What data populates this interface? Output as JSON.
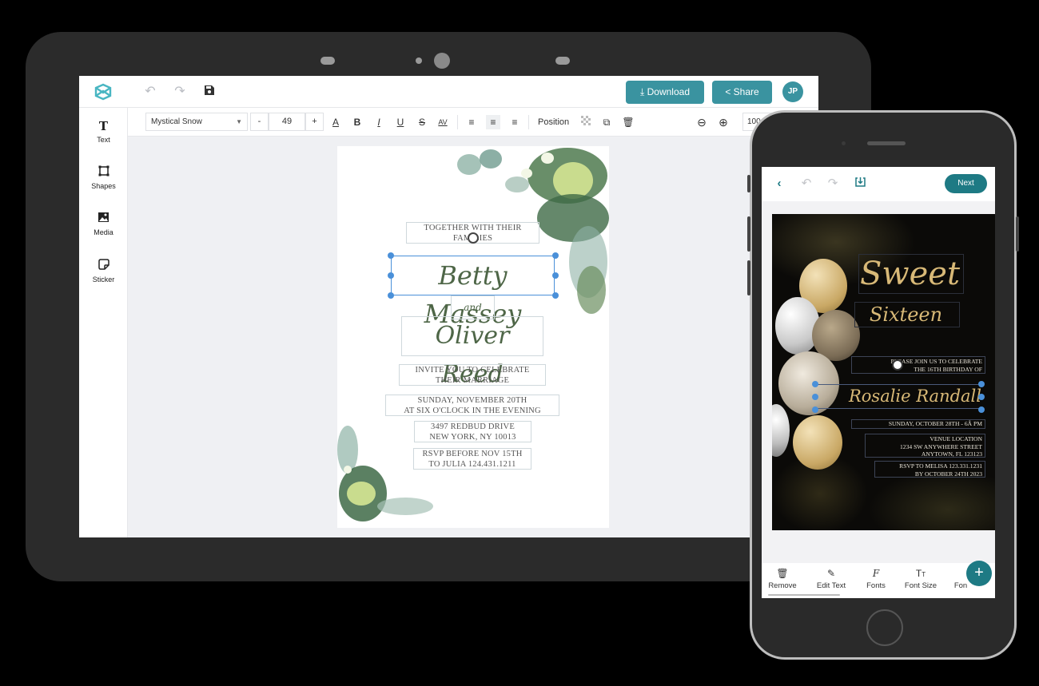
{
  "desktop": {
    "topbar": {
      "logo": "app-logo-icon",
      "undo_icon": "undo-icon",
      "redo_icon": "redo-icon",
      "save_icon": "save-icon",
      "download_label": "Download",
      "download_icon": "download-icon",
      "share_label": "Share",
      "share_icon": "share-icon",
      "avatar_initials": "JP",
      "accent_color": "#3a93a0"
    },
    "sidebar": {
      "items": [
        {
          "label": "Text",
          "icon": "text-icon"
        },
        {
          "label": "Shapes",
          "icon": "shapes-icon"
        },
        {
          "label": "Media",
          "icon": "media-icon"
        },
        {
          "label": "Sticker",
          "icon": "sticker-icon"
        }
      ]
    },
    "format_bar": {
      "font_family": "Mystical Snow",
      "decrease_label": "-",
      "font_size": "49",
      "increase_label": "+",
      "format_buttons": [
        "text-color",
        "bold",
        "italic",
        "underline",
        "strikethrough",
        "letter-spacing"
      ],
      "align_buttons": [
        "align-left",
        "align-center",
        "align-right"
      ],
      "align_active": "align-center",
      "position_label": "Position",
      "zoom_value": "100"
    },
    "invitation": {
      "line1": "TOGETHER WITH THEIR",
      "line2": "FAMILIES",
      "bride": "Betty Massey",
      "and": "and",
      "groom": "Oliver Reed",
      "invite_line1": "INVITE YOU TO CELEBRATE",
      "invite_line2": "THEIR MARRIAGE",
      "date_line1": "SUNDAY, NOVEMBER 20TH",
      "date_line2": "AT SIX O'CLOCK IN THE EVENING",
      "address_line1": "3497 REDBUD DRIVE",
      "address_line2": "NEW YORK, NY 10013",
      "rsvp_line1": "RSVP BEFORE NOV 15TH",
      "rsvp_line2": "TO JULIA 124.431.1211"
    }
  },
  "mobile": {
    "topbar": {
      "back_icon": "chevron-left-icon",
      "undo_icon": "undo-icon",
      "redo_icon": "redo-icon",
      "save_icon": "download-box-icon",
      "next_label": "Next",
      "accent_color": "#1e7a84"
    },
    "card": {
      "title1": "Sweet",
      "title2": "Sixteen",
      "intro_line1": "PLEASE JOIN US TO CELEBRATE",
      "intro_line2": "THE 16TH BIRTHDAY OF",
      "name": "Rosalie Randall",
      "date": "SUNDAY, OCTOBER 28TH - 6Â PM",
      "venue_line1": "VENUE LOCATION",
      "venue_line2": "1234 SW ANYWHERE STREET",
      "venue_line3": "ANYTOWN, FL 123123",
      "rsvp_line1": "RSVP TO MELISA 123.331.1231",
      "rsvp_line2": "BY OCTOBER 24TH 2023"
    },
    "bottom_tools": [
      {
        "label": "Remove",
        "icon": "trash-icon"
      },
      {
        "label": "Edit Text",
        "icon": "pencil-icon"
      },
      {
        "label": "Fonts",
        "icon": "font-icon"
      },
      {
        "label": "Font Size",
        "icon": "font-size-icon"
      },
      {
        "label": "Fon",
        "icon": ""
      }
    ],
    "fab_label": "+"
  }
}
